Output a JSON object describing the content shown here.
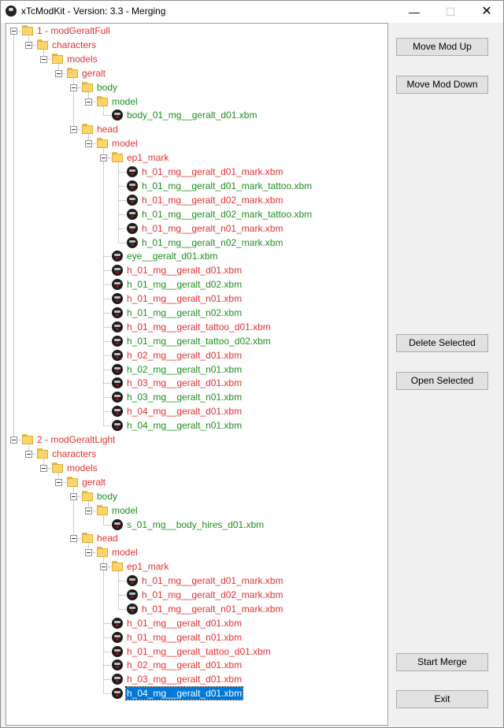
{
  "window": {
    "title": "xTcModKit - Version: 3.3 - Merging"
  },
  "buttons": {
    "move_up": "Move Mod Up",
    "move_down": "Move Mod Down",
    "delete_selected": "Delete Selected",
    "open_selected": "Open Selected",
    "start_merge": "Start Merge",
    "exit": "Exit"
  },
  "tree": [
    {
      "label": "1 - modGeraltFull",
      "depth": 0,
      "type": "folder",
      "color": "red",
      "expanded": true
    },
    {
      "label": "characters",
      "depth": 1,
      "type": "folder",
      "color": "red",
      "expanded": true
    },
    {
      "label": "models",
      "depth": 2,
      "type": "folder",
      "color": "red",
      "expanded": true
    },
    {
      "label": "geralt",
      "depth": 3,
      "type": "folder",
      "color": "red",
      "expanded": true
    },
    {
      "label": "body",
      "depth": 4,
      "type": "folder",
      "color": "green",
      "expanded": true
    },
    {
      "label": "model",
      "depth": 5,
      "type": "folder",
      "color": "green",
      "expanded": true
    },
    {
      "label": "body_01_mg__geralt_d01.xbm",
      "depth": 6,
      "type": "file",
      "color": "green"
    },
    {
      "label": "head",
      "depth": 4,
      "type": "folder",
      "color": "red",
      "expanded": true
    },
    {
      "label": "model",
      "depth": 5,
      "type": "folder",
      "color": "red",
      "expanded": true
    },
    {
      "label": "ep1_mark",
      "depth": 6,
      "type": "folder",
      "color": "red",
      "expanded": true
    },
    {
      "label": "h_01_mg__geralt_d01_mark.xbm",
      "depth": 7,
      "type": "file",
      "color": "red"
    },
    {
      "label": "h_01_mg__geralt_d01_mark_tattoo.xbm",
      "depth": 7,
      "type": "file",
      "color": "green"
    },
    {
      "label": "h_01_mg__geralt_d02_mark.xbm",
      "depth": 7,
      "type": "file",
      "color": "red"
    },
    {
      "label": "h_01_mg__geralt_d02_mark_tattoo.xbm",
      "depth": 7,
      "type": "file",
      "color": "green"
    },
    {
      "label": "h_01_mg__geralt_n01_mark.xbm",
      "depth": 7,
      "type": "file",
      "color": "red"
    },
    {
      "label": "h_01_mg__geralt_n02_mark.xbm",
      "depth": 7,
      "type": "file",
      "color": "green"
    },
    {
      "label": "eye__geralt_d01.xbm",
      "depth": 6,
      "type": "file",
      "color": "green"
    },
    {
      "label": "h_01_mg__geralt_d01.xbm",
      "depth": 6,
      "type": "file",
      "color": "red"
    },
    {
      "label": "h_01_mg__geralt_d02.xbm",
      "depth": 6,
      "type": "file",
      "color": "green"
    },
    {
      "label": "h_01_mg__geralt_n01.xbm",
      "depth": 6,
      "type": "file",
      "color": "red"
    },
    {
      "label": "h_01_mg__geralt_n02.xbm",
      "depth": 6,
      "type": "file",
      "color": "green"
    },
    {
      "label": "h_01_mg__geralt_tattoo_d01.xbm",
      "depth": 6,
      "type": "file",
      "color": "red"
    },
    {
      "label": "h_01_mg__geralt_tattoo_d02.xbm",
      "depth": 6,
      "type": "file",
      "color": "green"
    },
    {
      "label": "h_02_mg__geralt_d01.xbm",
      "depth": 6,
      "type": "file",
      "color": "red"
    },
    {
      "label": "h_02_mg__geralt_n01.xbm",
      "depth": 6,
      "type": "file",
      "color": "green"
    },
    {
      "label": "h_03_mg__geralt_d01.xbm",
      "depth": 6,
      "type": "file",
      "color": "red"
    },
    {
      "label": "h_03_mg__geralt_n01.xbm",
      "depth": 6,
      "type": "file",
      "color": "green"
    },
    {
      "label": "h_04_mg__geralt_d01.xbm",
      "depth": 6,
      "type": "file",
      "color": "red"
    },
    {
      "label": "h_04_mg__geralt_n01.xbm",
      "depth": 6,
      "type": "file",
      "color": "green"
    },
    {
      "label": "2 - modGeraltLight",
      "depth": 0,
      "type": "folder",
      "color": "red",
      "expanded": true
    },
    {
      "label": "characters",
      "depth": 1,
      "type": "folder",
      "color": "red",
      "expanded": true
    },
    {
      "label": "models",
      "depth": 2,
      "type": "folder",
      "color": "red",
      "expanded": true
    },
    {
      "label": "geralt",
      "depth": 3,
      "type": "folder",
      "color": "red",
      "expanded": true
    },
    {
      "label": "body",
      "depth": 4,
      "type": "folder",
      "color": "green",
      "expanded": true
    },
    {
      "label": "model",
      "depth": 5,
      "type": "folder",
      "color": "green",
      "expanded": true
    },
    {
      "label": "s_01_mg__body_hires_d01.xbm",
      "depth": 6,
      "type": "file",
      "color": "green"
    },
    {
      "label": "head",
      "depth": 4,
      "type": "folder",
      "color": "red",
      "expanded": true
    },
    {
      "label": "model",
      "depth": 5,
      "type": "folder",
      "color": "red",
      "expanded": true
    },
    {
      "label": "ep1_mark",
      "depth": 6,
      "type": "folder",
      "color": "red",
      "expanded": true
    },
    {
      "label": "h_01_mg__geralt_d01_mark.xbm",
      "depth": 7,
      "type": "file",
      "color": "red"
    },
    {
      "label": "h_01_mg__geralt_d02_mark.xbm",
      "depth": 7,
      "type": "file",
      "color": "red"
    },
    {
      "label": "h_01_mg__geralt_n01_mark.xbm",
      "depth": 7,
      "type": "file",
      "color": "red"
    },
    {
      "label": "h_01_mg__geralt_d01.xbm",
      "depth": 6,
      "type": "file",
      "color": "red"
    },
    {
      "label": "h_01_mg__geralt_n01.xbm",
      "depth": 6,
      "type": "file",
      "color": "red"
    },
    {
      "label": "h_01_mg__geralt_tattoo_d01.xbm",
      "depth": 6,
      "type": "file",
      "color": "red"
    },
    {
      "label": "h_02_mg__geralt_d01.xbm",
      "depth": 6,
      "type": "file",
      "color": "red"
    },
    {
      "label": "h_03_mg__geralt_d01.xbm",
      "depth": 6,
      "type": "file",
      "color": "red"
    },
    {
      "label": "h_04_mg__geralt_d01.xbm",
      "depth": 6,
      "type": "file",
      "color": "red",
      "selected": true
    }
  ],
  "colors": {
    "red": "#e5312f",
    "green": "#1f8f1f",
    "selection": "#0078d7"
  },
  "icons": {
    "folder": "folder-icon",
    "file": "witcher-medallion-icon",
    "expander": "collapse-box-icon"
  }
}
